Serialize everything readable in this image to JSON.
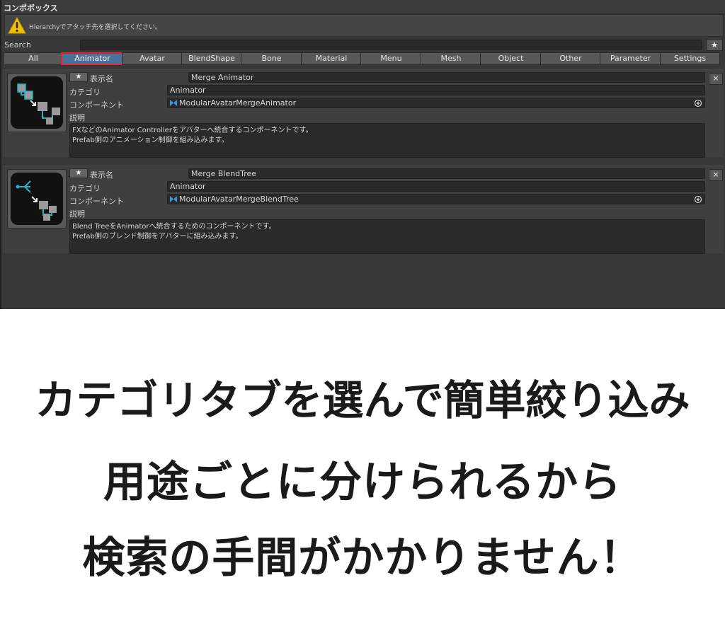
{
  "window": {
    "title": "コンポボックス"
  },
  "helpbox": {
    "icon": "warning-icon",
    "message": "Hierarchyでアタッチ先を選択してください。"
  },
  "search": {
    "label": "Search",
    "value": "",
    "favorite_label": "★"
  },
  "tabs": [
    {
      "label": "All",
      "active": false
    },
    {
      "label": "Animator",
      "active": true
    },
    {
      "label": "Avatar",
      "active": false
    },
    {
      "label": "BlendShape",
      "active": false
    },
    {
      "label": "Bone",
      "active": false
    },
    {
      "label": "Material",
      "active": false
    },
    {
      "label": "Menu",
      "active": false
    },
    {
      "label": "Mesh",
      "active": false
    },
    {
      "label": "Object",
      "active": false
    },
    {
      "label": "Other",
      "active": false
    },
    {
      "label": "Parameter",
      "active": false
    },
    {
      "label": "Settings",
      "active": false
    }
  ],
  "field_labels": {
    "star": "★",
    "display_name": "表示名",
    "category": "カテゴリ",
    "component": "コンポーネント",
    "description": "説明",
    "close": "×"
  },
  "items": [
    {
      "display_name": "Merge Animator",
      "category": "Animator",
      "component": "ModularAvatarMergeAnimator",
      "description": [
        "FXなどのAnimator Controllerをアバターへ統合するコンポーネントです。",
        "Prefab側のアニメーション制御を組み込みます。"
      ],
      "icon": "merge-animator-icon"
    },
    {
      "display_name": "Merge BlendTree",
      "category": "Animator",
      "component": "ModularAvatarMergeBlendTree",
      "description": [
        "Blend TreeをAnimatorへ統合するためのコンポーネントです。",
        "Prefab側のブレンド制御をアバターに組み込みます。"
      ],
      "icon": "merge-blendtree-icon"
    }
  ],
  "caption": {
    "lines": [
      "カテゴリタブを選んで簡単絞り込み",
      "用途ごとに分けられるから",
      "検索の手間がかかりません！"
    ]
  },
  "colors": {
    "panel": "#383838",
    "active_tab": "#4a6f9a",
    "highlight_border": "#e0262c",
    "icon_accent": "#1fb6c9"
  }
}
